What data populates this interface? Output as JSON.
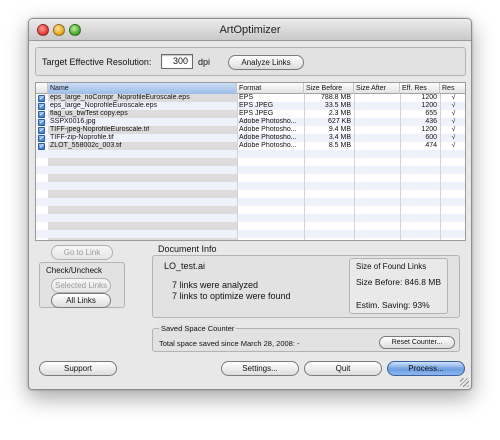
{
  "window": {
    "title": "ArtOptimizer"
  },
  "resolution": {
    "label": "Target Effective Resolution:",
    "value": "300",
    "unit": "dpi"
  },
  "analyze_button": "Analyze Links",
  "table": {
    "columns": [
      "Name",
      "Format",
      "Size Before",
      "Size After",
      "Eff. Res",
      "Res"
    ],
    "rows": [
      {
        "name": "eps_large_noCompr_NoprofileEuroscale.eps",
        "format": "EPS",
        "size_before": "788.8 MB",
        "size_after": "",
        "eff_res": "1200",
        "res": "√"
      },
      {
        "name": "eps_large_NoprofileEuroscale.eps",
        "format": "EPS JPEG",
        "size_before": "33.5 MB",
        "size_after": "",
        "eff_res": "1200",
        "res": "√"
      },
      {
        "name": "flag_us_bwTest copy.eps",
        "format": "EPS JPEG",
        "size_before": "2.3 MB",
        "size_after": "",
        "eff_res": "655",
        "res": "√"
      },
      {
        "name": "SSPX0016.jpg",
        "format": "Adobe Photosho...",
        "size_before": "627 KB",
        "size_after": "",
        "eff_res": "436",
        "res": "√"
      },
      {
        "name": "TIFF-jpeg-NoprofileEuroscale.tif",
        "format": "Adobe Photosho...",
        "size_before": "9.4 MB",
        "size_after": "",
        "eff_res": "1200",
        "res": "√"
      },
      {
        "name": "TIFF-zip-Noprofile.tif",
        "format": "Adobe Photosho...",
        "size_before": "3.4 MB",
        "size_after": "",
        "eff_res": "600",
        "res": "√"
      },
      {
        "name": "ZLOT_558002c_003.tif",
        "format": "Adobe Photosho...",
        "size_before": "8.5 MB",
        "size_after": "",
        "eff_res": "474",
        "res": "√"
      }
    ]
  },
  "left_panel": {
    "go_to_link": "Go to Link",
    "check_group_label": "Check/Uncheck",
    "selected_links": "Selected Links",
    "all_links": "All Links"
  },
  "document_info": {
    "label": "Document Info",
    "filename": "LO_test.ai",
    "analyzed": "7 links were analyzed",
    "to_optimize": "7 links to optimize were found",
    "size_found_label": "Size of Found Links",
    "size_before": "Size Before: 846.8 MB",
    "estim_saving": "Estim. Saving: 93%"
  },
  "saved_space": {
    "label": "Saved Space Counter",
    "text": "Total space saved since March 28, 2008: -",
    "reset_button": "Reset Counter..."
  },
  "bottom_buttons": {
    "support": "Support",
    "settings": "Settings...",
    "quit": "Quit",
    "process": "Process..."
  },
  "colors": {
    "accent": "#6f9fe0",
    "checkbox": "#3f7ad2",
    "window_bg": "#e8e8e8"
  }
}
